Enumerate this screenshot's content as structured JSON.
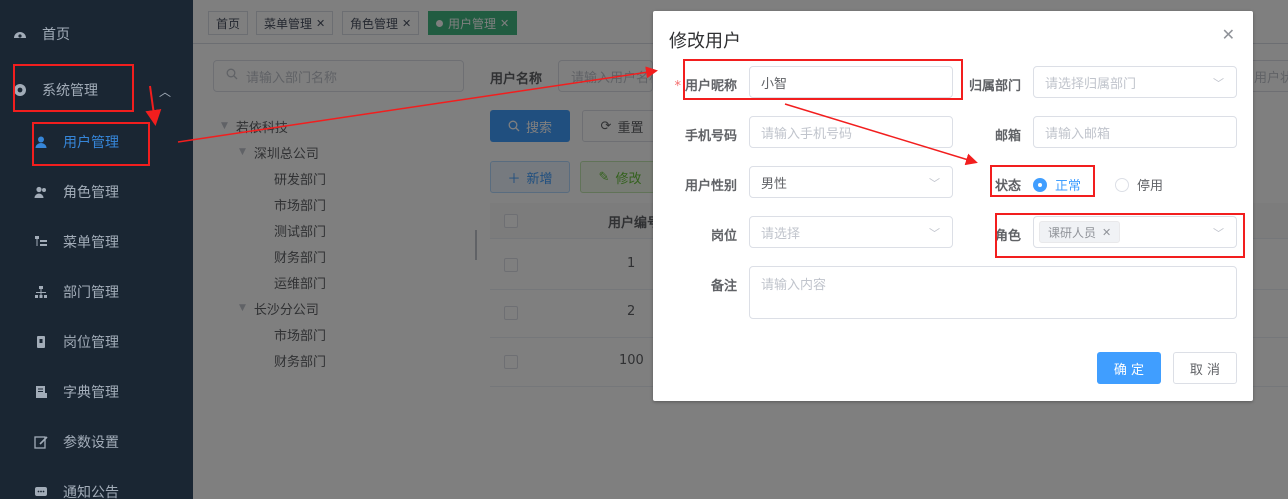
{
  "sidebar": {
    "items": [
      {
        "label": "首页",
        "icon": "dashboard-icon"
      },
      {
        "label": "系统管理",
        "icon": "gear-icon"
      },
      {
        "label": "用户管理",
        "icon": "user-icon"
      },
      {
        "label": "角色管理",
        "icon": "peoples-icon"
      },
      {
        "label": "菜单管理",
        "icon": "tree-table-icon"
      },
      {
        "label": "部门管理",
        "icon": "tree-icon"
      },
      {
        "label": "岗位管理",
        "icon": "post-icon"
      },
      {
        "label": "字典管理",
        "icon": "dict-icon"
      },
      {
        "label": "参数设置",
        "icon": "edit-icon"
      },
      {
        "label": "通知公告",
        "icon": "message-icon"
      }
    ]
  },
  "tags": [
    {
      "label": "首页",
      "closable": false
    },
    {
      "label": "菜单管理",
      "closable": true
    },
    {
      "label": "角色管理",
      "closable": true
    },
    {
      "label": "用户管理",
      "closable": true,
      "active": true
    }
  ],
  "dept": {
    "search_placeholder": "请输入部门名称",
    "tree": {
      "root": "若依科技",
      "shenzhen": "深圳总公司",
      "sz_children": [
        "研发部门",
        "市场部门",
        "测试部门",
        "财务部门",
        "运维部门"
      ],
      "changsha": "长沙分公司",
      "cs_children": [
        "市场部门",
        "财务部门"
      ]
    }
  },
  "query": {
    "username_label": "用户名称",
    "username_placeholder": "请输入用户名称",
    "status_partial": "用户状",
    "search_btn": "搜索",
    "reset_btn": "重置",
    "add_btn": "新增",
    "edit_btn": "修改"
  },
  "table": {
    "col_id": "用户编号",
    "rows": [
      "1",
      "2",
      "100"
    ]
  },
  "dialog": {
    "title": "修改用户",
    "nickname_label": "用户昵称",
    "nickname_value": "小智",
    "dept_label": "归属部门",
    "dept_placeholder": "请选择归属部门",
    "phone_label": "手机号码",
    "phone_placeholder": "请输入手机号码",
    "email_label": "邮箱",
    "email_placeholder": "请输入邮箱",
    "sex_label": "用户性别",
    "sex_value": "男性",
    "status_label": "状态",
    "status_options": [
      "正常",
      "停用"
    ],
    "post_label": "岗位",
    "post_placeholder": "请选择",
    "role_label": "角色",
    "role_tag": "课研人员",
    "remark_label": "备注",
    "remark_placeholder": "请输入内容",
    "confirm_btn": "确 定",
    "cancel_btn": "取 消"
  },
  "colors": {
    "sidebar_bg": "#1f2d3d",
    "accent": "#409eff",
    "annotation": "#f21e1e"
  }
}
